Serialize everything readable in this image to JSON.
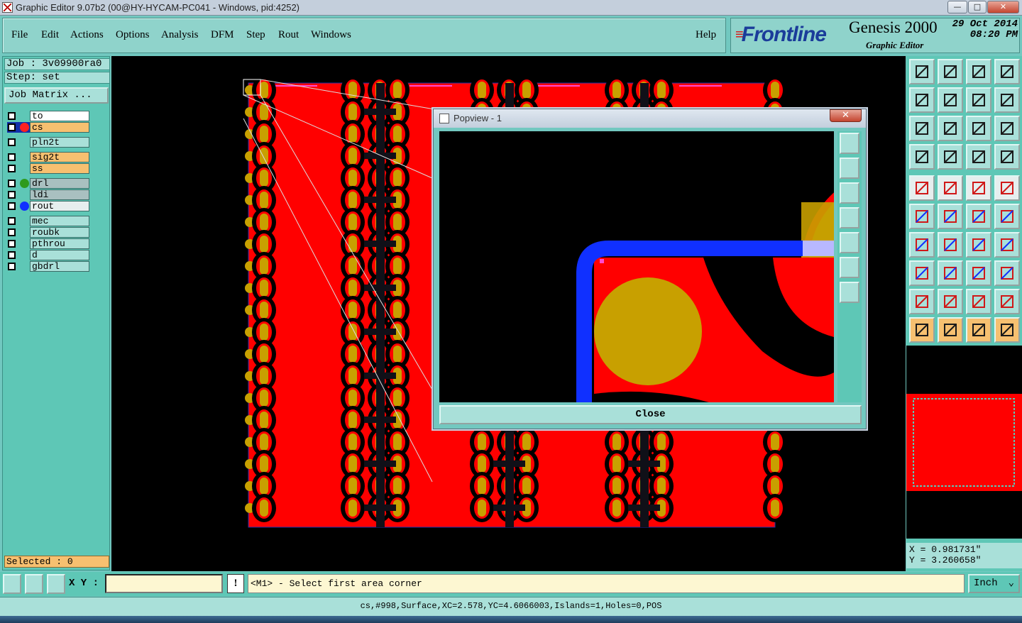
{
  "window": {
    "title": "Graphic Editor 9.07b2 (00@HY-HYCAM-PC041 - Windows, pid:4252)",
    "min": "—",
    "max": "□",
    "close": "✕"
  },
  "menu": [
    "File",
    "Edit",
    "Actions",
    "Options",
    "Analysis",
    "DFM",
    "Step",
    "Rout",
    "Windows"
  ],
  "help": "Help",
  "brand": {
    "logo_a": "F",
    "logo_b": "rontline",
    "product": "Genesis 2000",
    "subtitle": "Graphic Editor",
    "date": "29 Oct 2014",
    "time": "08:20 PM"
  },
  "job": {
    "job_text": "Job : 3v09900ra0",
    "step_text": "Step: set",
    "matrix_button": "Job Matrix ..."
  },
  "layers": [
    {
      "name": "to",
      "color": "#ffffff",
      "dot": ""
    },
    {
      "name": "cs",
      "color": "#f7c070",
      "dot": "#ff2020"
    },
    {
      "name": "pln2t",
      "color": "#a9e0d9",
      "dot": ""
    },
    {
      "name": "sig2t",
      "color": "#f7c070",
      "dot": ""
    },
    {
      "name": "ss",
      "color": "#f7c070",
      "dot": ""
    },
    {
      "name": "drl",
      "color": "#a9c0c0",
      "dot": "#2e9a1e"
    },
    {
      "name": "ldi",
      "color": "#a9c0c0",
      "dot": ""
    },
    {
      "name": "rout",
      "color": "#e6eeee",
      "dot": "#1030ff"
    },
    {
      "name": "mec",
      "color": "#a9e0d9",
      "dot": ""
    },
    {
      "name": "roubk",
      "color": "#a9e0d9",
      "dot": ""
    },
    {
      "name": "pthrou",
      "color": "#a9e0d9",
      "dot": ""
    },
    {
      "name": "d",
      "color": "#a9e0d9",
      "dot": ""
    },
    {
      "name": "gbdrl",
      "color": "#a9e0d9",
      "dot": ""
    }
  ],
  "selected_text": "Selected : 0",
  "popview": {
    "title": "Popview - 1",
    "close_button": "Close",
    "close_x": "✕"
  },
  "coords": {
    "x": "X = 0.981731\"",
    "y": "Y = 3.260658\""
  },
  "bottom": {
    "xy_label": "X Y :",
    "xy_value": "",
    "warn": "!",
    "prompt": "<M1> - Select first area corner",
    "units": "Inch"
  },
  "status": "cs,#998,Surface,XC=2.578,YC=4.6066003,Islands=1,Holes=0,POS",
  "colors": {
    "copper": "#ff0000",
    "pad": "#c8a000",
    "rout": "#1030ff",
    "panel_bg": "#5ec7b6",
    "button": "#a9e0d9",
    "accent": "#f7c070"
  },
  "toolbar_icons": [
    "zoom-home-icon",
    "zoom-in-icon",
    "zoom-page-icon",
    "window-split-icon",
    "pan-left-icon",
    "pan-right-icon",
    "mirror-icon",
    "snake-icon",
    "fit-icon",
    "center-icon",
    "ratio-icon",
    "help-icon",
    "filter-icon",
    "grid-icon",
    "layers-red-icon",
    "layers-black-icon",
    "feature-pick-icon",
    "color-edit-icon",
    "ruler-icon",
    "dot-icon",
    "node-icon",
    "cross-icon",
    "line-pad-icon",
    "arc-pad-icon",
    "angle-icon",
    "line-icon",
    "rotate-icon",
    "split-icon",
    "move-icon",
    "dash-icon",
    "measure-icon",
    "shapes-icon",
    "tri-a-icon",
    "tri-b-icon",
    "tri-c-icon",
    "tri-d-icon",
    "pointer-icon",
    "pointer-box-icon",
    "pointer-circle-icon",
    "pointer-path-icon"
  ]
}
